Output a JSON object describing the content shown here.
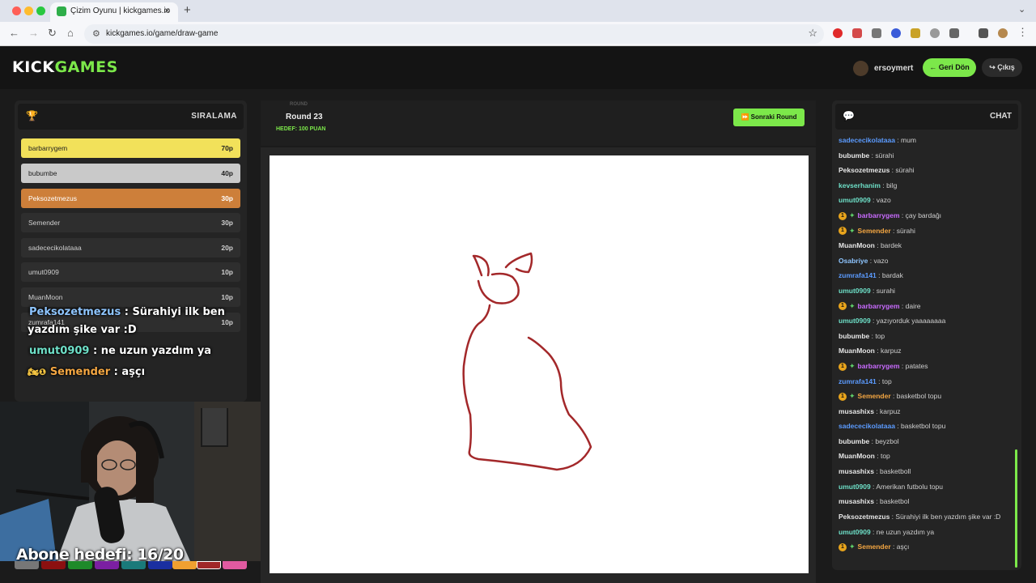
{
  "browser": {
    "tab_title": "Çizim Oyunu | kickgames.io",
    "url": "kickgames.io/game/draw-game",
    "new_tab": "+",
    "close_tab": "×"
  },
  "header": {
    "logo_part1": "KICK",
    "logo_part2": "GAMES",
    "username": "ersoymert",
    "back_label": "Geri Dön",
    "exit_label": "Çıkış"
  },
  "leaderboard": {
    "title": "SIRALAMA",
    "entries": [
      {
        "name": "barbarrygem",
        "points": "70p"
      },
      {
        "name": "bubumbe",
        "points": "40p"
      },
      {
        "name": "Peksozetmezus",
        "points": "30p"
      },
      {
        "name": "Semender",
        "points": "30p"
      },
      {
        "name": "sadececikolataaa",
        "points": "20p"
      },
      {
        "name": "umut0909",
        "points": "10p"
      },
      {
        "name": "MuanMoon",
        "points": "10p"
      },
      {
        "name": "zumrafa141",
        "points": "10p"
      }
    ]
  },
  "overlay": {
    "line1_user": "Peksozetmezus",
    "line1_text": " : Sürahiyi ilk ben",
    "line1_cont": "yazdım şike var :D",
    "line2_user": "umut0909",
    "line2_text": " : ne uzun yazdım ya",
    "line3_prefix": "🏍❶",
    "line3_user": "Semender",
    "line3_text": " : aşçı",
    "goal": "Abone hedefi: 16/20"
  },
  "round": {
    "small_label": "ROUND",
    "title": "Round 23",
    "goal": "HEDEF: 100 PUAN",
    "next_label": "Sonraki Round"
  },
  "chat": {
    "title": "CHAT",
    "messages": [
      {
        "user": "sadececikolataaa",
        "color": "#5b9bff",
        "text": "mum",
        "badge": false
      },
      {
        "user": "bubumbe",
        "color": "#e6e6e6",
        "text": "sürahi",
        "badge": false
      },
      {
        "user": "Peksozetmezus",
        "color": "#e6e6e6",
        "text": "sürahi",
        "badge": false
      },
      {
        "user": "kevserhanim",
        "color": "#6ee0c8",
        "text": "bilg",
        "badge": false
      },
      {
        "user": "umut0909",
        "color": "#6ee0c8",
        "text": "vazo",
        "badge": false
      },
      {
        "user": "barbarrygem",
        "color": "#c96bff",
        "text": "çay bardağı",
        "badge": true
      },
      {
        "user": "Semender",
        "color": "#f5a742",
        "text": "sürahi",
        "badge": true
      },
      {
        "user": "MuanMoon",
        "color": "#e6e6e6",
        "text": "bardek",
        "badge": false
      },
      {
        "user": "Osabriye",
        "color": "#8ec5ff",
        "text": "vazo",
        "badge": false
      },
      {
        "user": "zumrafa141",
        "color": "#5b9bff",
        "text": "bardak",
        "badge": false
      },
      {
        "user": "umut0909",
        "color": "#6ee0c8",
        "text": "surahi",
        "badge": false
      },
      {
        "user": "barbarrygem",
        "color": "#c96bff",
        "text": "daire",
        "badge": true
      },
      {
        "user": "umut0909",
        "color": "#6ee0c8",
        "text": "yazıyorduk yaaaaaaaa",
        "badge": false
      },
      {
        "user": "bubumbe",
        "color": "#e6e6e6",
        "text": "top",
        "badge": false
      },
      {
        "user": "MuanMoon",
        "color": "#e6e6e6",
        "text": "karpuz",
        "badge": false
      },
      {
        "user": "barbarrygem",
        "color": "#c96bff",
        "text": "patates",
        "badge": true
      },
      {
        "user": "zumrafa141",
        "color": "#5b9bff",
        "text": "top",
        "badge": false
      },
      {
        "user": "Semender",
        "color": "#f5a742",
        "text": "basketbol topu",
        "badge": true
      },
      {
        "user": "musashixs",
        "color": "#e6e6e6",
        "text": "karpuz",
        "badge": false
      },
      {
        "user": "sadececikolataaa",
        "color": "#5b9bff",
        "text": "basketbol topu",
        "badge": false
      },
      {
        "user": "bubumbe",
        "color": "#e6e6e6",
        "text": "beyzbol",
        "badge": false
      },
      {
        "user": "MuanMoon",
        "color": "#e6e6e6",
        "text": "top",
        "badge": false
      },
      {
        "user": "musashixs",
        "color": "#e6e6e6",
        "text": "basketboll",
        "badge": false
      },
      {
        "user": "umut0909",
        "color": "#6ee0c8",
        "text": "Amerikan futbolu topu",
        "badge": false
      },
      {
        "user": "musashixs",
        "color": "#e6e6e6",
        "text": "basketbol",
        "badge": false
      },
      {
        "user": "Peksozetmezus",
        "color": "#e6e6e6",
        "text": "Sürahiyi ilk ben yazdım şike var :D",
        "badge": false,
        "wrap": true
      },
      {
        "user": "umut0909",
        "color": "#6ee0c8",
        "text": "ne uzun yazdım ya",
        "badge": false
      },
      {
        "user": "Semender",
        "color": "#f5a742",
        "text": "aşçı",
        "badge": true
      }
    ]
  }
}
